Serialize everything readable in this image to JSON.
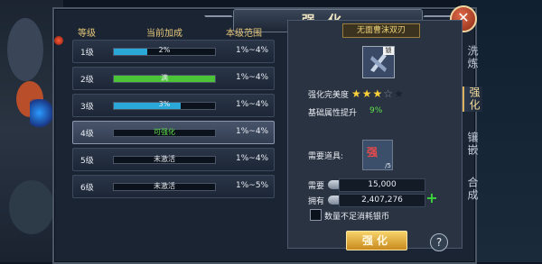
{
  "window": {
    "title": "强化",
    "close_label": "✕"
  },
  "table": {
    "headers": {
      "level": "等级",
      "current": "当前加成",
      "range": "本级范围"
    },
    "rows": [
      {
        "level": "1级",
        "bar_text": "2%",
        "range": "1%~4%",
        "progress": 0.33,
        "fill_color": "#2aa8d8",
        "selected": false
      },
      {
        "level": "2级",
        "bar_text": "满",
        "range": "1%~4%",
        "progress": 1.0,
        "fill_color": "#4cc438",
        "selected": false
      },
      {
        "level": "3级",
        "bar_text": "3%",
        "range": "1%~4%",
        "progress": 0.66,
        "fill_color": "#2aa8d8",
        "selected": false
      },
      {
        "level": "4级",
        "bar_text": "可强化",
        "range": "1%~4%",
        "progress": 0.0,
        "fill_color": "#2aa8d8",
        "selected": true,
        "bar_text_color": "#5fe04a"
      },
      {
        "level": "5级",
        "bar_text": "未激活",
        "range": "1%~4%",
        "progress": 0.0,
        "fill_color": "#2aa8d8",
        "selected": false
      },
      {
        "level": "6级",
        "bar_text": "未激活",
        "range": "1%~5%",
        "progress": 0.0,
        "fill_color": "#2aa8d8",
        "selected": false
      }
    ]
  },
  "item": {
    "name": "无面曹沫双刃",
    "icon_tag": "锁",
    "perfection_label": "强化完美度",
    "perfection_stars": 3,
    "perfection_max": 5,
    "bonus_label": "基础属性提升",
    "bonus_value": "9%"
  },
  "requirement": {
    "label": "需要道具:",
    "item_glyph": "强",
    "item_count": "/5",
    "need_label": "需要",
    "need_value": "15,000",
    "own_label": "拥有",
    "own_value": "2,407,276",
    "add_label": "+",
    "checkbox_label": "数量不足消耗银币"
  },
  "actions": {
    "confirm_label": "强化",
    "help_label": "?"
  },
  "side_tabs": [
    {
      "label": "洗炼",
      "active": false
    },
    {
      "label": "强化",
      "active": true
    },
    {
      "label": "镶嵌",
      "active": false
    },
    {
      "label": "合成",
      "active": false
    }
  ]
}
